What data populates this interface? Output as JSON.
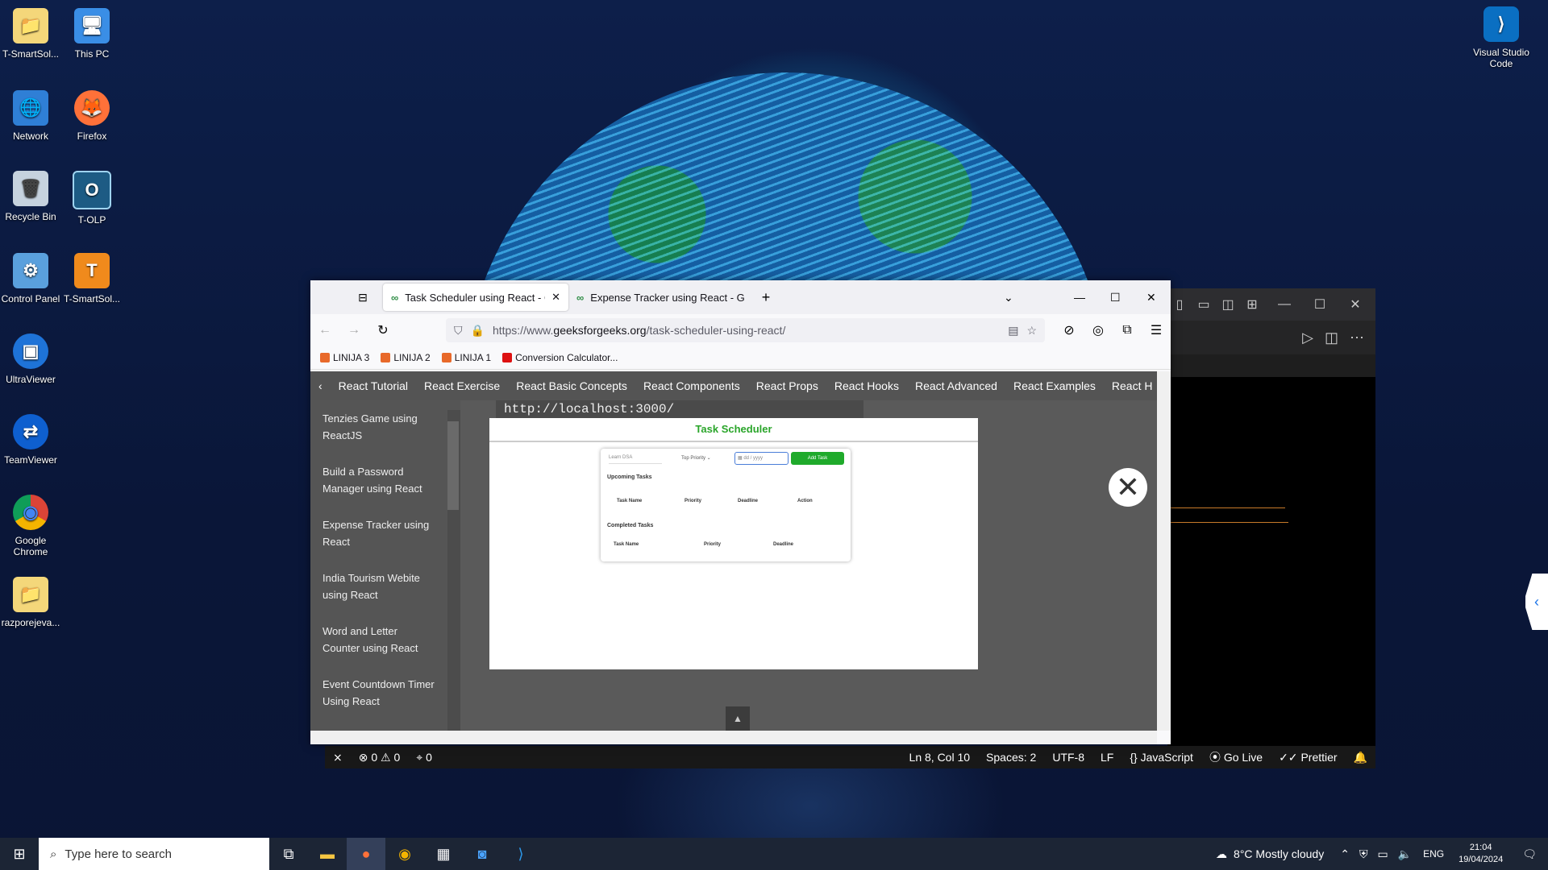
{
  "desktop": {
    "icons": [
      {
        "label": "T-SmartSol...",
        "glyph": "📁"
      },
      {
        "label": "This PC",
        "glyph": "🖥"
      },
      {
        "label": "Network",
        "glyph": "🌐"
      },
      {
        "label": "Firefox",
        "glyph": "🦊"
      },
      {
        "label": "Recycle Bin",
        "glyph": "🗑"
      },
      {
        "label": "T-OLP",
        "glyph": "O"
      },
      {
        "label": "Control Panel",
        "glyph": "⚙"
      },
      {
        "label": "T-SmartSol...",
        "glyph": "T"
      },
      {
        "label": "UltraViewer",
        "glyph": "▣"
      },
      {
        "label": "TeamViewer",
        "glyph": "⇄"
      },
      {
        "label": "Google Chrome",
        "glyph": "◉"
      },
      {
        "label": "razporejeva...",
        "glyph": "📁"
      },
      {
        "label": "Visual Studio Code",
        "glyph": "⟩"
      }
    ]
  },
  "firefox": {
    "tabs": [
      {
        "label": "Task Scheduler using React - Ge"
      },
      {
        "label": "Expense Tracker using React - G"
      }
    ],
    "url_prefix": "https://www.",
    "url_domain": "geeksforgeeks.org",
    "url_path": "/task-scheduler-using-react/",
    "bookmarks": [
      "LINIJA 3",
      "LINIJA 2",
      "LINIJA 1",
      "Conversion Calculator..."
    ]
  },
  "page": {
    "topnav": [
      "React Tutorial",
      "React Exercise",
      "React Basic Concepts",
      "React Components",
      "React Props",
      "React Hooks",
      "React Advanced",
      "React Examples",
      "React H"
    ],
    "sidebar": [
      "Tenzies Game using ReactJS",
      "Build a Password Manager using React",
      "Expense Tracker using React",
      "India Tourism Webite using React",
      "Word and Letter Counter using React",
      "Event Countdown Timer Using React"
    ],
    "localhost": "http://localhost:3000/",
    "app": {
      "title": "Task Scheduler",
      "task_placeholder": "Learn DSA",
      "priority_value": "Top Priority",
      "date_placeholder": "dd / yyyy",
      "add_button": "Add Task",
      "upcoming_heading": "Upcoming Tasks",
      "upcoming_columns": [
        "Task Name",
        "Priority",
        "Deadline",
        "Action"
      ],
      "completed_heading": "Completed Tasks",
      "completed_columns": [
        "Task Name",
        "Priority",
        "Deadline"
      ]
    }
  },
  "statusbar": {
    "errors": "0",
    "warnings": "0",
    "ports": "0",
    "position": "Ln 8, Col 10",
    "spaces": "Spaces: 2",
    "encoding": "UTF-8",
    "eol": "LF",
    "language": "JavaScript",
    "golive": "Go Live",
    "prettier": "Prettier"
  },
  "taskbar": {
    "search_placeholder": "Type here to search",
    "weather": "8°C  Mostly cloudy",
    "language": "ENG",
    "time": "21:04",
    "date": "19/04/2024"
  }
}
